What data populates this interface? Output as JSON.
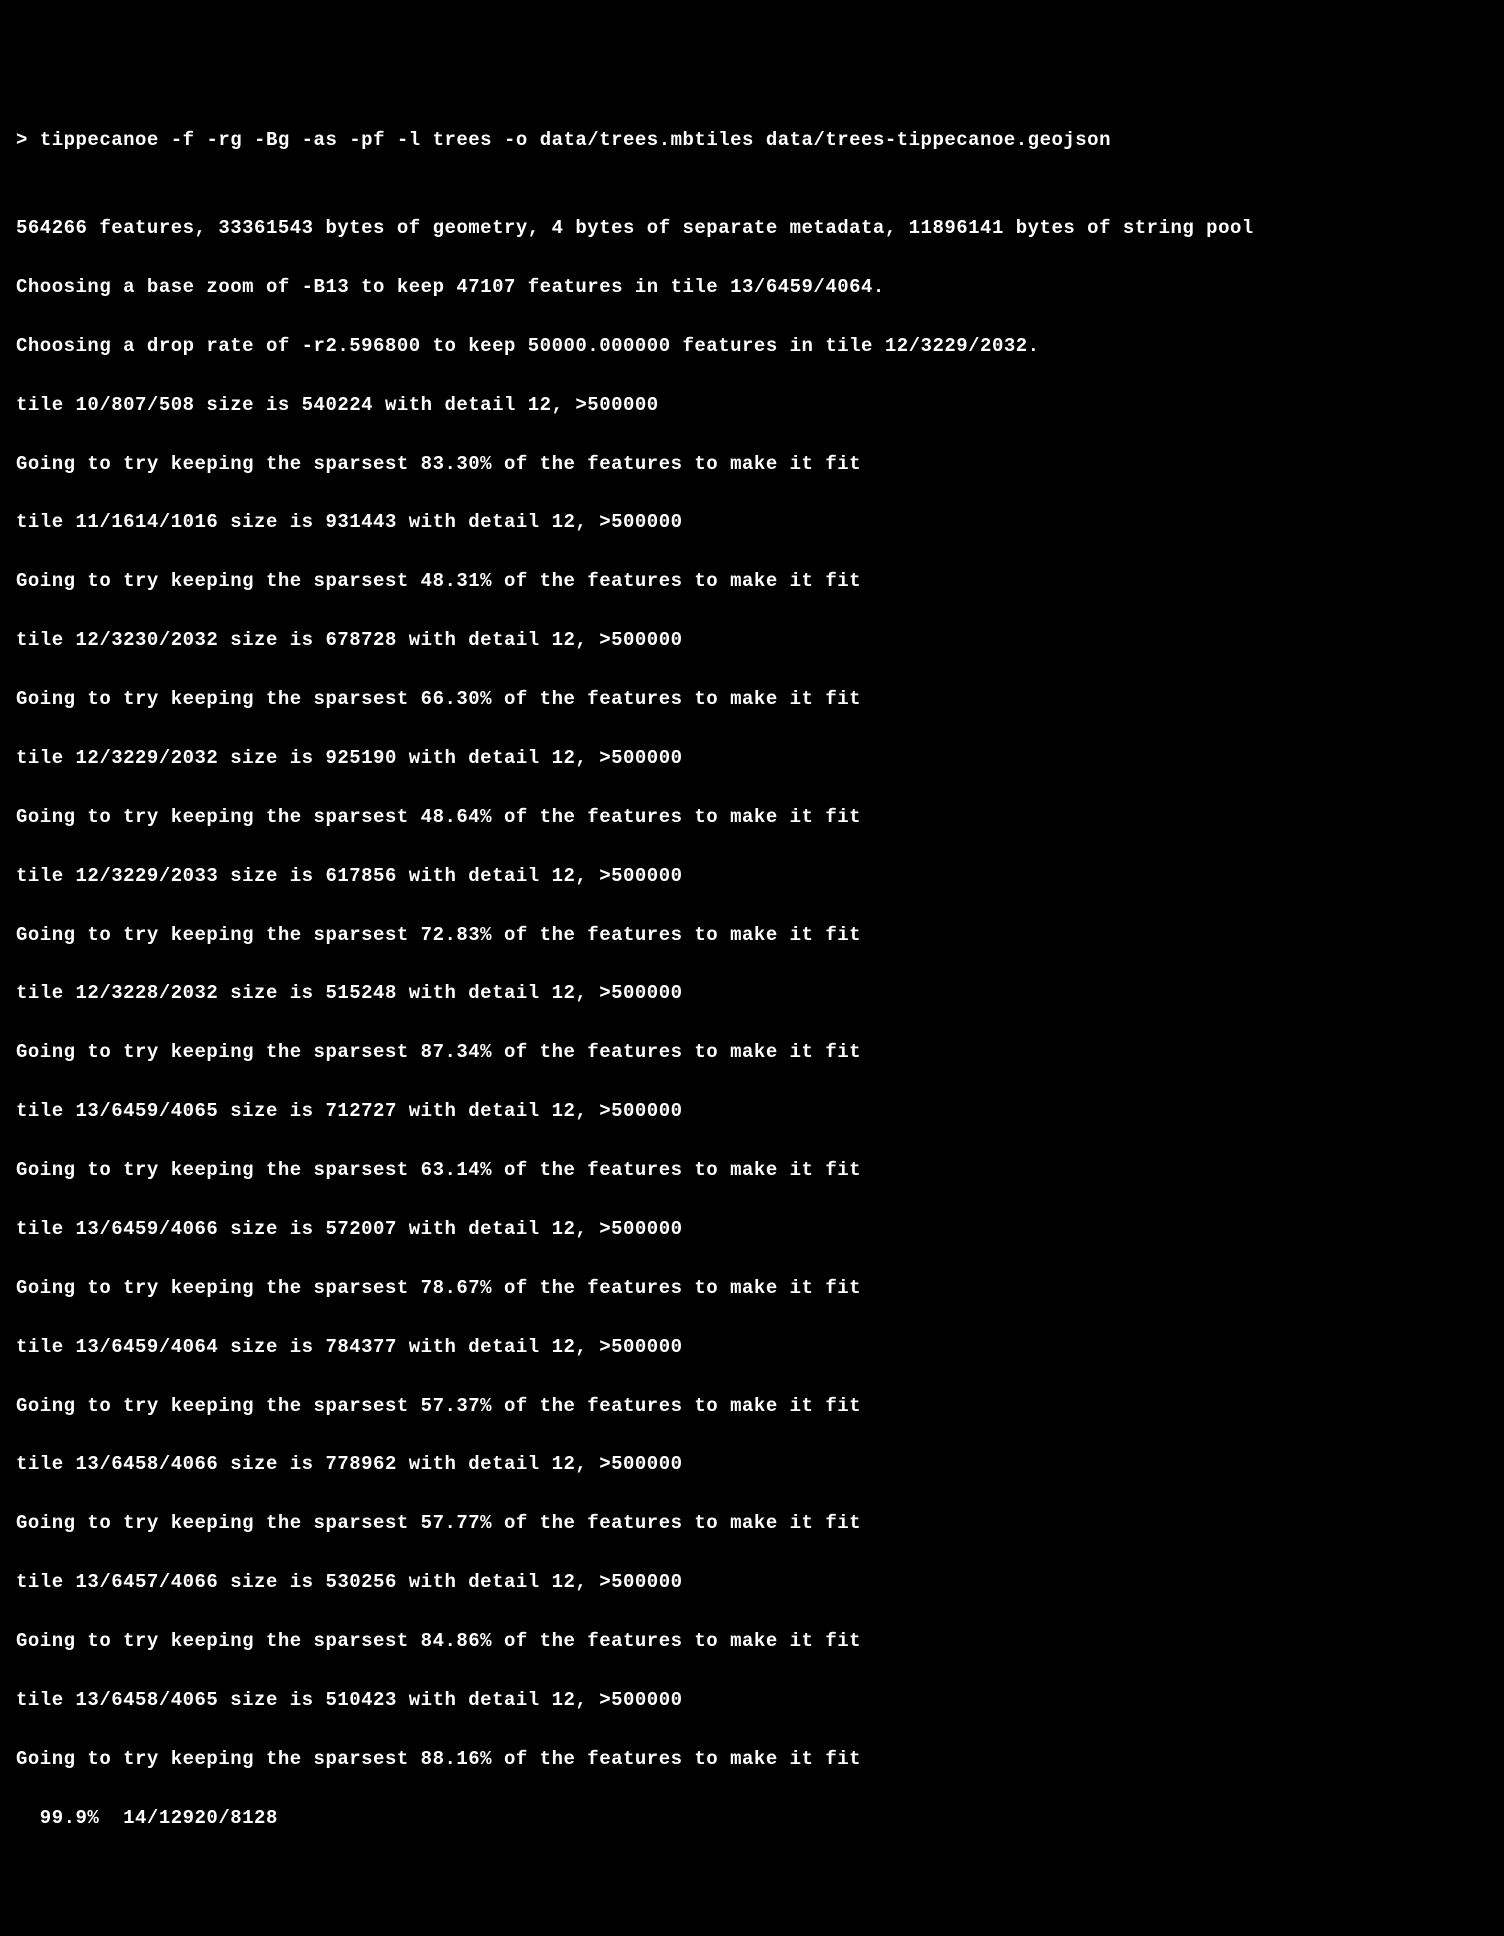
{
  "command": {
    "prompt": "> ",
    "text": "tippecanoe -f -rg -Bg -as -pf -l trees -o data/trees.mbtiles data/trees-tippecanoe.geojson"
  },
  "blank": "",
  "summary": "564266 features, 33361543 bytes of geometry, 4 bytes of separate metadata, 11896141 bytes of string pool",
  "base_zoom": "Choosing a base zoom of -B13 to keep 47107 features in tile 13/6459/4064.",
  "drop_rate": "Choosing a drop rate of -r2.596800 to keep 50000.000000 features in tile 12/3229/2032.",
  "lines": [
    "tile 10/807/508 size is 540224 with detail 12, >500000",
    "Going to try keeping the sparsest 83.30% of the features to make it fit",
    "tile 11/1614/1016 size is 931443 with detail 12, >500000",
    "Going to try keeping the sparsest 48.31% of the features to make it fit",
    "tile 12/3230/2032 size is 678728 with detail 12, >500000",
    "Going to try keeping the sparsest 66.30% of the features to make it fit",
    "tile 12/3229/2032 size is 925190 with detail 12, >500000",
    "Going to try keeping the sparsest 48.64% of the features to make it fit",
    "tile 12/3229/2033 size is 617856 with detail 12, >500000",
    "Going to try keeping the sparsest 72.83% of the features to make it fit",
    "tile 12/3228/2032 size is 515248 with detail 12, >500000",
    "Going to try keeping the sparsest 87.34% of the features to make it fit",
    "tile 13/6459/4065 size is 712727 with detail 12, >500000",
    "Going to try keeping the sparsest 63.14% of the features to make it fit",
    "tile 13/6459/4066 size is 572007 with detail 12, >500000",
    "Going to try keeping the sparsest 78.67% of the features to make it fit",
    "tile 13/6459/4064 size is 784377 with detail 12, >500000",
    "Going to try keeping the sparsest 57.37% of the features to make it fit",
    "tile 13/6458/4066 size is 778962 with detail 12, >500000",
    "Going to try keeping the sparsest 57.77% of the features to make it fit",
    "tile 13/6457/4066 size is 530256 with detail 12, >500000",
    "Going to try keeping the sparsest 84.86% of the features to make it fit",
    "tile 13/6458/4065 size is 510423 with detail 12, >500000",
    "Going to try keeping the sparsest 88.16% of the features to make it fit"
  ],
  "progress": "  99.9%  14/12920/8128"
}
